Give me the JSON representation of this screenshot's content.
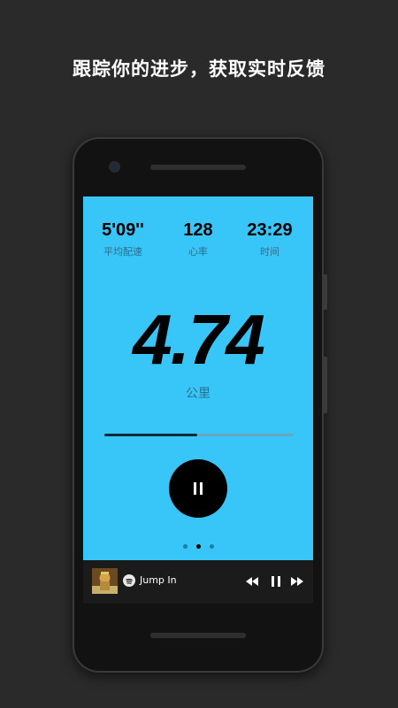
{
  "headline": "跟踪你的进步，获取实时反馈",
  "stats": [
    {
      "value": "5'09''",
      "label": "平均配速"
    },
    {
      "value": "128",
      "label": "心率"
    },
    {
      "value": "23:29",
      "label": "时间"
    }
  ],
  "distance": {
    "value": "4.74",
    "unit": "公里"
  },
  "route_progress": 0.49,
  "pager": {
    "count": 3,
    "active_index": 1
  },
  "now_playing": {
    "service_icon": "spotify-icon",
    "track": "Jump In",
    "controls": [
      "rewind-icon",
      "pause-icon",
      "fast-forward-icon"
    ]
  },
  "colors": {
    "screen_bg": "#38c6f9",
    "label_text": "#2b6f8c",
    "page_bg": "#2a2a2a"
  }
}
